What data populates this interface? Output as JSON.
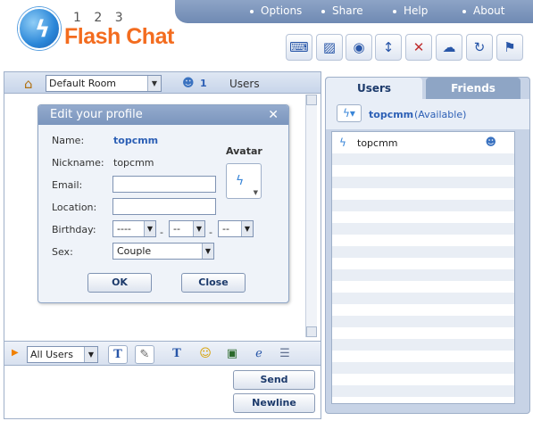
{
  "app": {
    "logo_numbers": "1 2 3",
    "logo_text": "Flash Chat"
  },
  "topbar": {
    "items": [
      {
        "label": "Options"
      },
      {
        "label": "Share"
      },
      {
        "label": "Help"
      },
      {
        "label": "About"
      }
    ]
  },
  "toolbar": {
    "buttons": [
      {
        "icon": "gamepad-icon"
      },
      {
        "icon": "skin-icon"
      },
      {
        "icon": "webcam-icon"
      },
      {
        "icon": "arrows-vertical-icon"
      },
      {
        "icon": "sound-muted-icon"
      },
      {
        "icon": "chat-bubble-icon"
      },
      {
        "icon": "refresh-icon"
      },
      {
        "icon": "exit-icon"
      }
    ]
  },
  "room_bar": {
    "room": "Default Room",
    "user_count": "1",
    "users_label": "Users"
  },
  "compose": {
    "audience": "All Users",
    "send_label": "Send",
    "newline_label": "Newline"
  },
  "side": {
    "tabs": [
      {
        "label": "Users"
      },
      {
        "label": "Friends"
      }
    ],
    "me": {
      "name": "topcmm",
      "status": "(Available)"
    },
    "users": [
      {
        "name": "topcmm"
      }
    ]
  },
  "profile_dialog": {
    "title": "Edit your profile",
    "labels": {
      "name": "Name:",
      "nickname": "Nickname:",
      "email": "Email:",
      "location": "Location:",
      "birthday": "Birthday:",
      "sex": "Sex:"
    },
    "name_value": "topcmm",
    "nickname_value": "topcmm",
    "email_value": "",
    "location_value": "",
    "birthday": {
      "year": "----",
      "month": "--",
      "day": "--",
      "separator": "-"
    },
    "sex_value": "Couple",
    "avatar_label": "Avatar",
    "ok_label": "OK",
    "close_label": "Close"
  },
  "colors": {
    "accent": "#2c5fb5",
    "logo_orange": "#f36c1f",
    "panel": "#c7d3e6"
  }
}
